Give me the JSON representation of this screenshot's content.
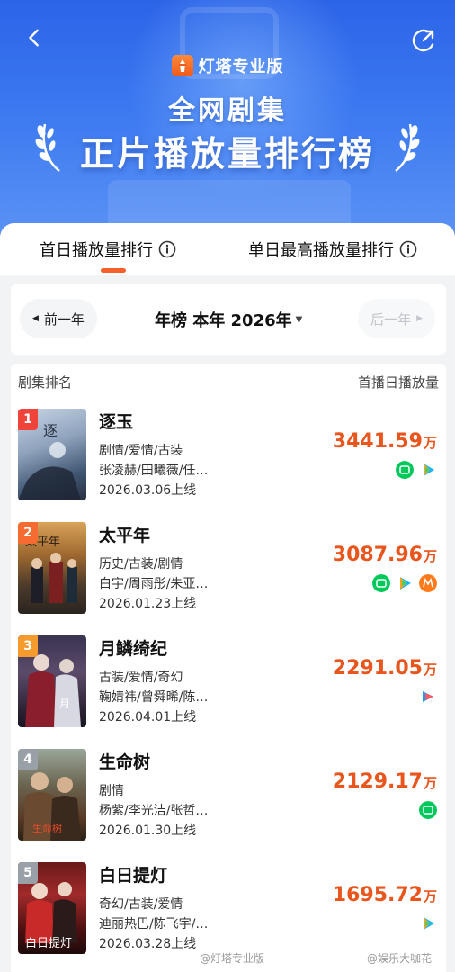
{
  "header": {
    "brand": "灯塔专业版",
    "title_line1": "全网剧集",
    "title_line2": "正片播放量排行榜"
  },
  "tabs": [
    {
      "label": "首日播放量排行"
    },
    {
      "label": "单日最高播放量排行"
    }
  ],
  "year_selector": {
    "prev": "前一年",
    "current": "年榜 本年 2026年",
    "next": "后一年"
  },
  "list": {
    "col_left": "剧集排名",
    "col_right": "首播日播放量",
    "items": [
      {
        "rank": "1",
        "title": "逐玉",
        "genre": "剧情/爱情/古装",
        "cast": "张凌赫/田曦薇/任…",
        "date": "2026.03.06上线",
        "plays": "3441.59",
        "unit": "万",
        "platforms": [
          "iqiyi-icon",
          "tencent-video-icon"
        ],
        "badge_color": "#f0443a"
      },
      {
        "rank": "2",
        "title": "太平年",
        "genre": "历史/古装/剧情",
        "cast": "白宇/周雨彤/朱亚…",
        "date": "2026.01.23上线",
        "plays": "3087.96",
        "unit": "万",
        "platforms": [
          "iqiyi-icon",
          "tencent-video-icon",
          "mango-tv-icon"
        ],
        "badge_color": "#f56b32"
      },
      {
        "rank": "3",
        "title": "月鳞绮纪",
        "genre": "古装/爱情/奇幻",
        "cast": "鞠婧祎/曾舜晞/陈…",
        "date": "2026.04.01上线",
        "plays": "2291.05",
        "unit": "万",
        "platforms": [
          "youku-icon"
        ],
        "badge_color": "#f59a2c"
      },
      {
        "rank": "4",
        "title": "生命树",
        "genre": "剧情",
        "cast": "杨紫/李光洁/张哲…",
        "date": "2026.01.30上线",
        "plays": "2129.17",
        "unit": "万",
        "platforms": [
          "iqiyi-icon"
        ],
        "badge_color": "#9aa0a8"
      },
      {
        "rank": "5",
        "title": "白日提灯",
        "genre": "奇幻/古装/爱情",
        "cast": "迪丽热巴/陈飞宇/…",
        "date": "2026.03.28上线",
        "plays": "1695.72",
        "unit": "万",
        "platforms": [
          "tencent-video-icon"
        ],
        "badge_color": "#9aa0a8"
      }
    ]
  },
  "watermarks": [
    "@灯塔专业版",
    "@娱乐大咖花"
  ]
}
